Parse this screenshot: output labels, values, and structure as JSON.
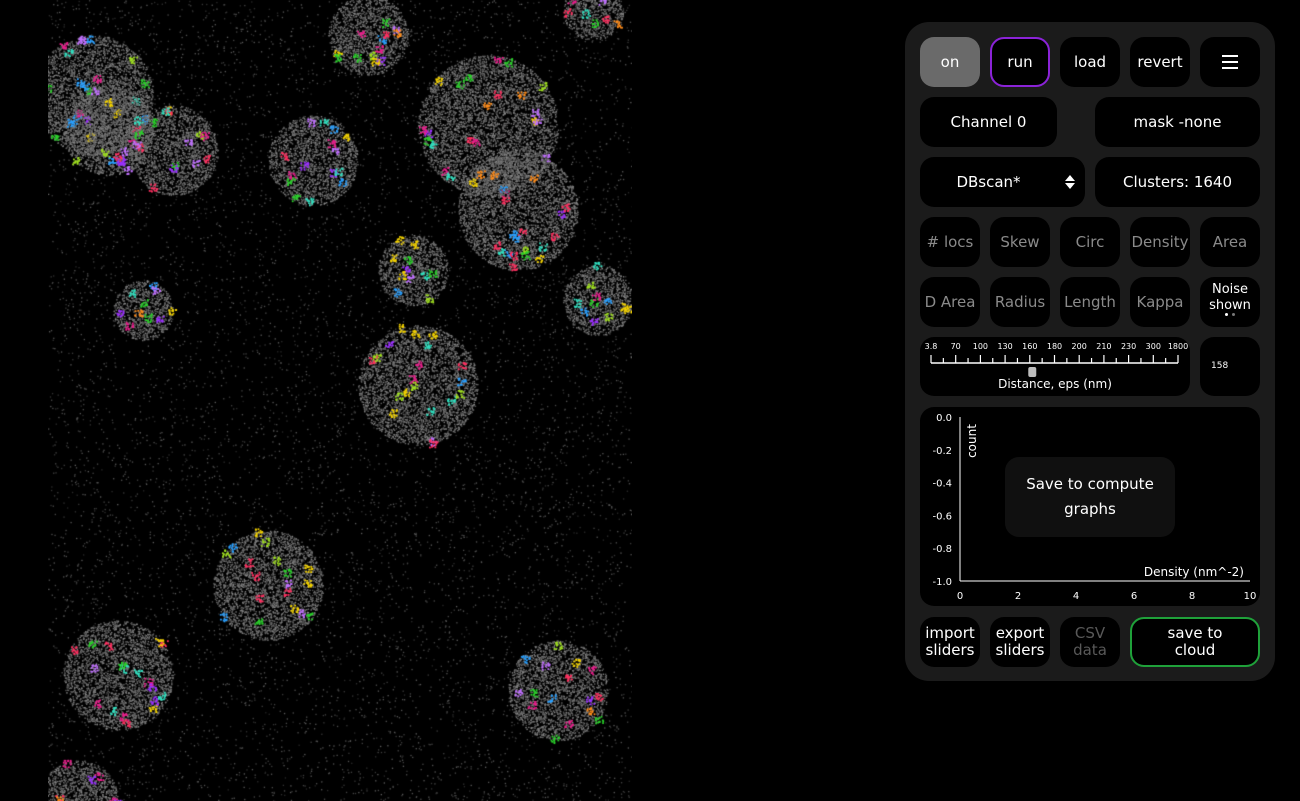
{
  "toolbar": {
    "on": "on",
    "run": "run",
    "load": "load",
    "revert": "revert",
    "menu_icon": "hamburger-menu-icon"
  },
  "channel": "Channel 0",
  "mask": "mask -none",
  "algorithm": {
    "selected": "DBscan*",
    "icon": "sort-updown-icon"
  },
  "clusters": "Clusters: 1640",
  "metrics_row1": [
    "# locs",
    "Skew",
    "Circ",
    "Density",
    "Area"
  ],
  "metrics_row2": [
    "D Area",
    "Radius",
    "Length",
    "Kappa"
  ],
  "noise": {
    "label_line1": "Noise",
    "label_line2": "shown"
  },
  "slider": {
    "ticks": [
      "3.8",
      "70",
      "100",
      "130",
      "160",
      "180",
      "200",
      "210",
      "230",
      "300",
      "1800"
    ],
    "label": "Distance, eps (nm)",
    "value": "158",
    "handle_fraction": 0.41
  },
  "graph": {
    "y_ticks": [
      "0.0",
      "-0.2",
      "-0.4",
      "-0.6",
      "-0.8",
      "-1.0"
    ],
    "x_ticks": [
      "0",
      "2",
      "4",
      "6",
      "8",
      "10"
    ],
    "y_label": "count",
    "x_label": "Density (nm^-2)",
    "overlay_line1": "Save to compute",
    "overlay_line2": "graphs"
  },
  "bottom": {
    "import_1": "import",
    "import_2": "sliders",
    "export_1": "export",
    "export_2": "sliders",
    "csv_1": "CSV",
    "csv_2": "data",
    "cloud_1": "save to",
    "cloud_2": "cloud"
  },
  "colors": {
    "run_border": "#8b23d8",
    "cloud_border": "#1fa13a",
    "panel": "#1b1b1b",
    "active": "#6a6a6a"
  }
}
